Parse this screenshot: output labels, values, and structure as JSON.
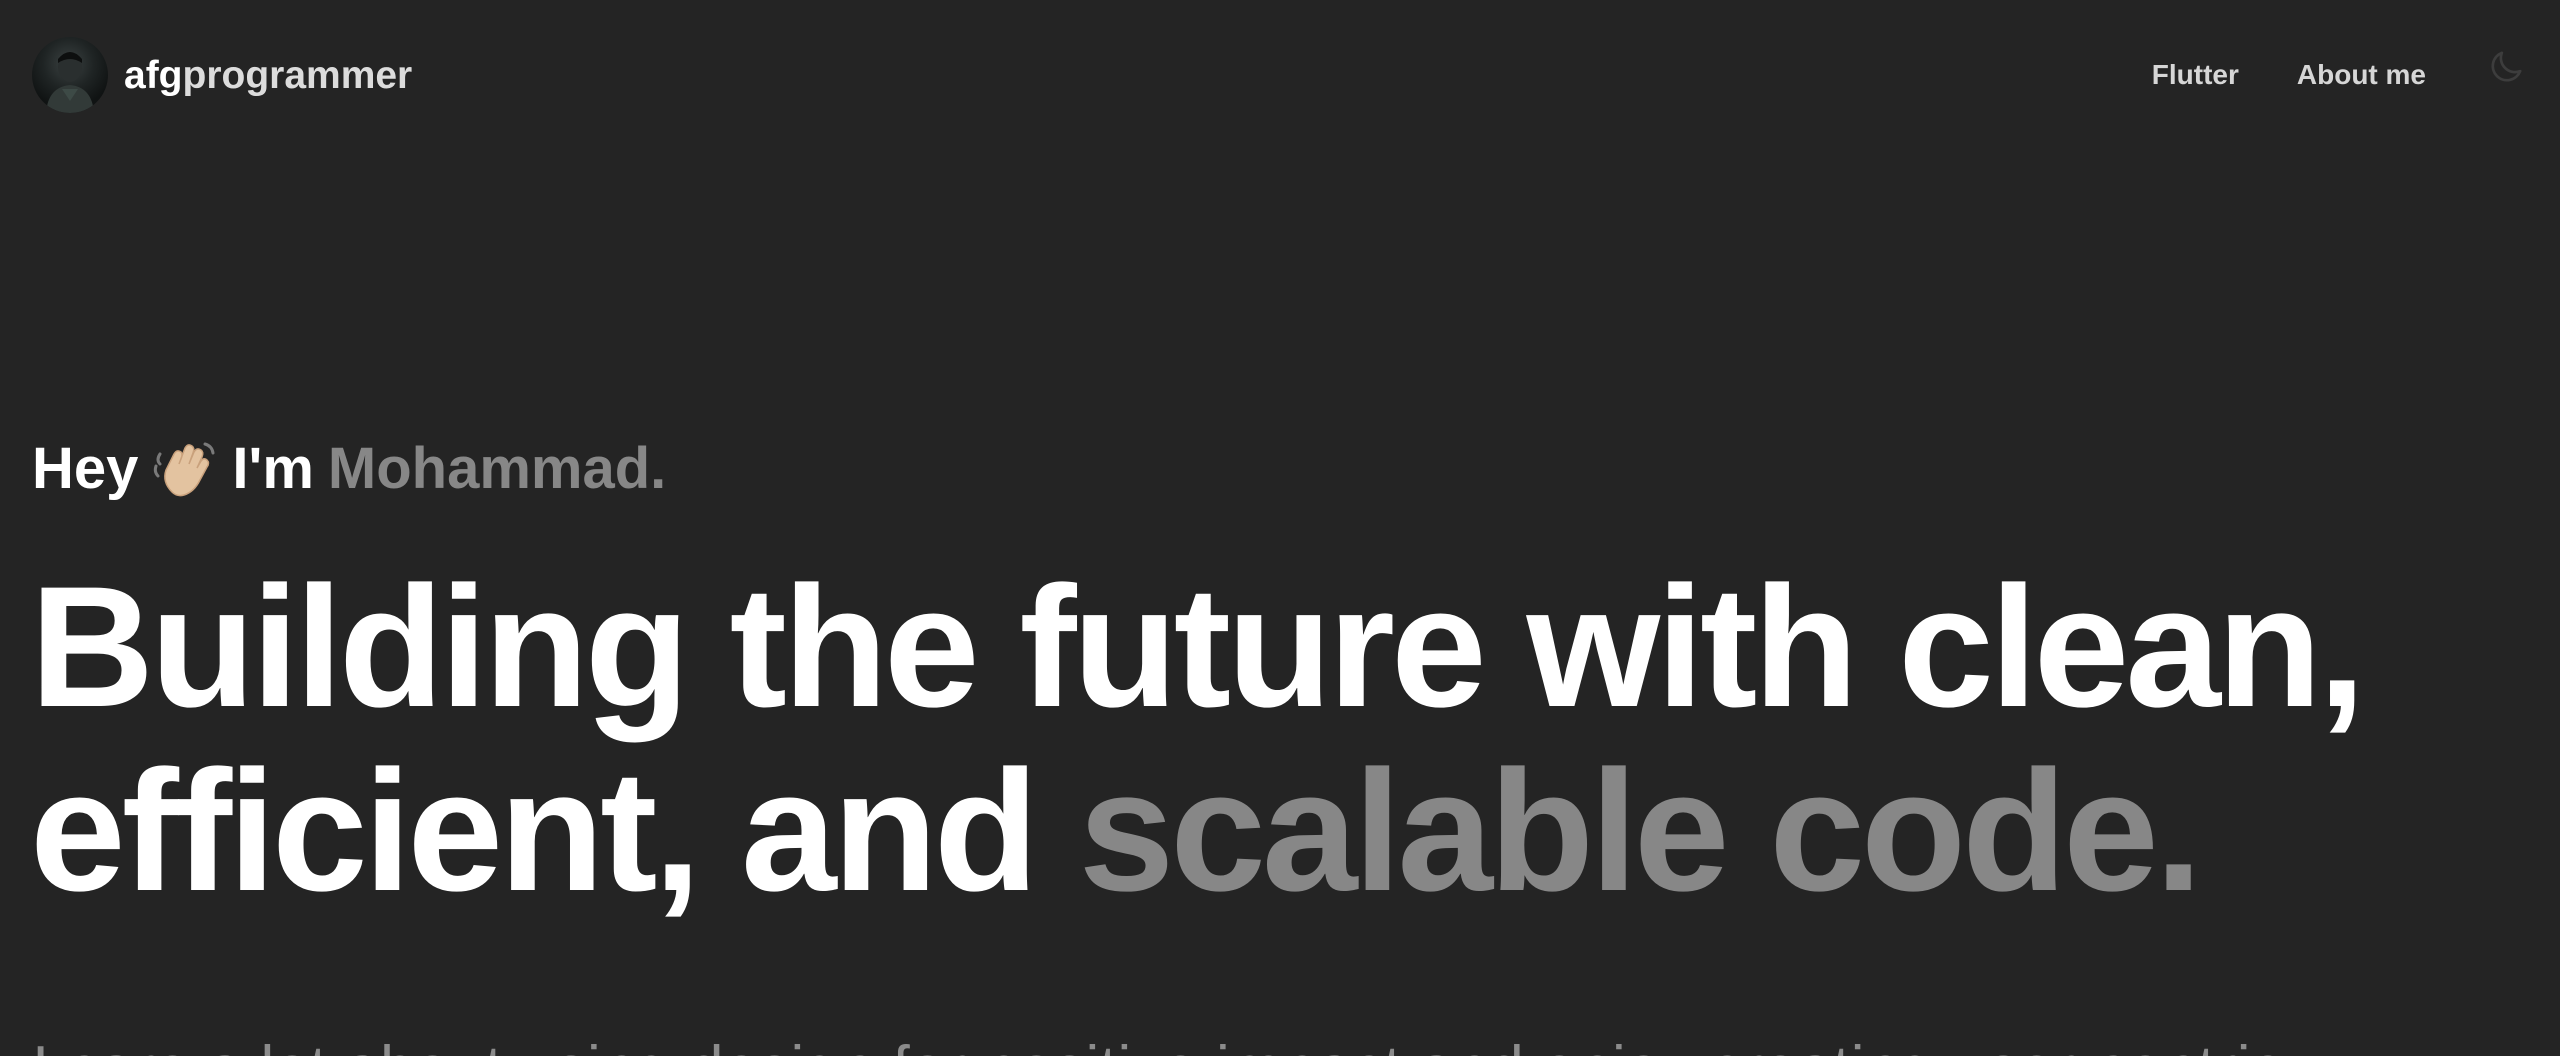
{
  "header": {
    "brand": {
      "name_part1": "afg",
      "name_part2": "programmer",
      "avatar_icon": "profile-photo"
    },
    "nav": {
      "items": [
        {
          "label": "Flutter"
        },
        {
          "label": "About me"
        }
      ],
      "theme_toggle_icon": "moon-icon"
    }
  },
  "hero": {
    "greeting": {
      "hey": "Hey",
      "emoji": "👋🏼",
      "im": "I'm",
      "name": "Mohammad."
    },
    "headline": {
      "line1": "Building the future with clean,",
      "line2_plain": "efficient, and",
      "line2_muted": "scalable code."
    },
    "intro": "I care a lot about using design for positive impact and enjoy creating user-centric,"
  },
  "colors": {
    "background": "#242424",
    "text_primary": "#ffffff",
    "text_muted": "#878787",
    "nav_text": "#d6d6d6"
  }
}
